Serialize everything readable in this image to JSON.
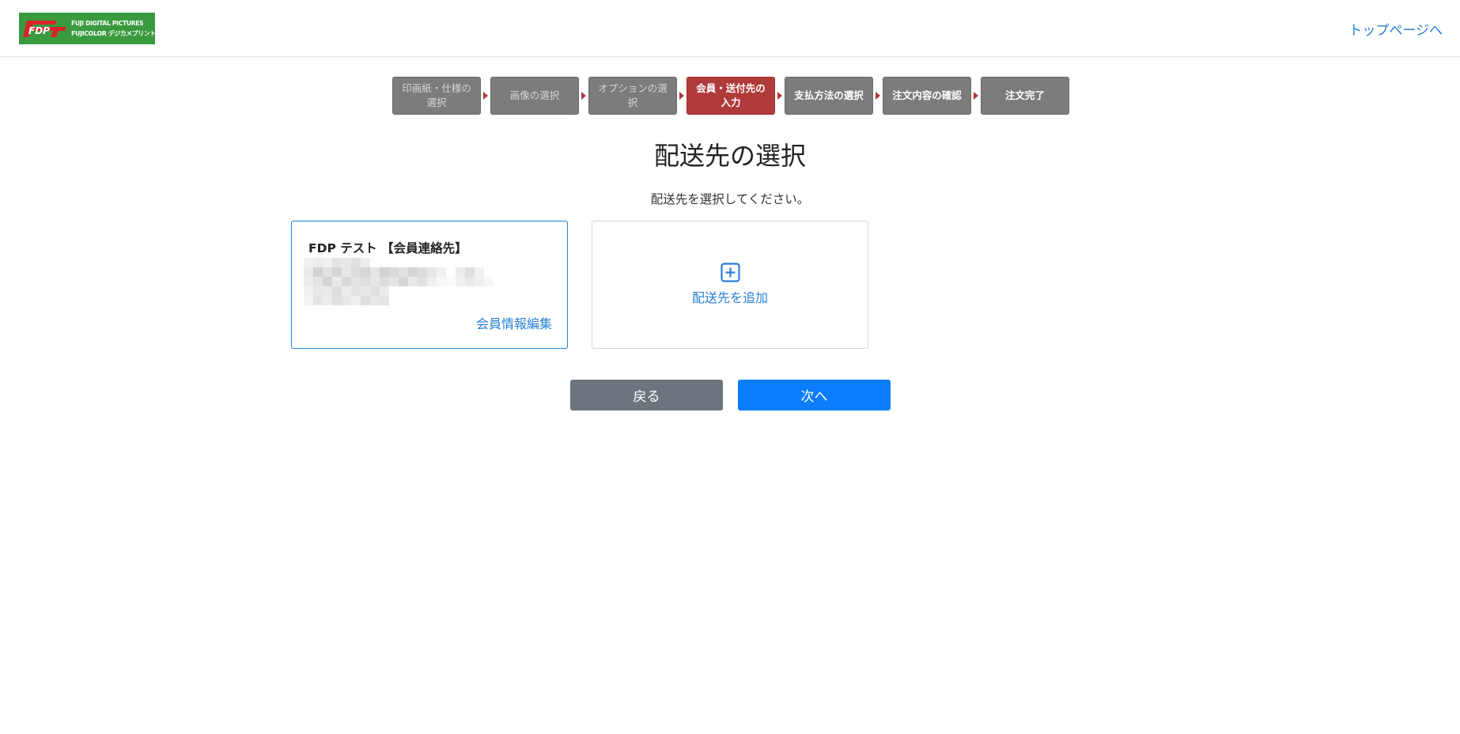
{
  "header": {
    "logo": {
      "mark": "FDP",
      "line1": "FUJI DIGITAL PICTURES",
      "line2": "FUJICOLOR デジカメプリント"
    },
    "top_link": "トップページへ"
  },
  "steps": [
    {
      "label": "印画紙・仕様の選択",
      "state": "done"
    },
    {
      "label": "画像の選択",
      "state": "done"
    },
    {
      "label": "オプションの選択",
      "state": "done"
    },
    {
      "label": "会員・送付先の入力",
      "state": "active"
    },
    {
      "label": "支払方法の選択",
      "state": "upcoming"
    },
    {
      "label": "注文内容の確認",
      "state": "upcoming"
    },
    {
      "label": "注文完了",
      "state": "upcoming"
    }
  ],
  "page": {
    "title": "配送先の選択",
    "instruction": "配送先を選択してください。"
  },
  "member_card": {
    "name": "FDP テスト 【会員連絡先】",
    "edit_link": "会員情報編集"
  },
  "add_card": {
    "icon": "plus-square-icon",
    "label": "配送先を追加"
  },
  "buttons": {
    "back": "戻る",
    "next": "次へ"
  },
  "colors": {
    "accent": "#0b7dfa",
    "link": "#2a7fd4",
    "step_active": "#b03a3a",
    "step_inactive": "#7c7c7c",
    "back_button": "#6c757d",
    "logo_green": "#3a9a3e"
  }
}
